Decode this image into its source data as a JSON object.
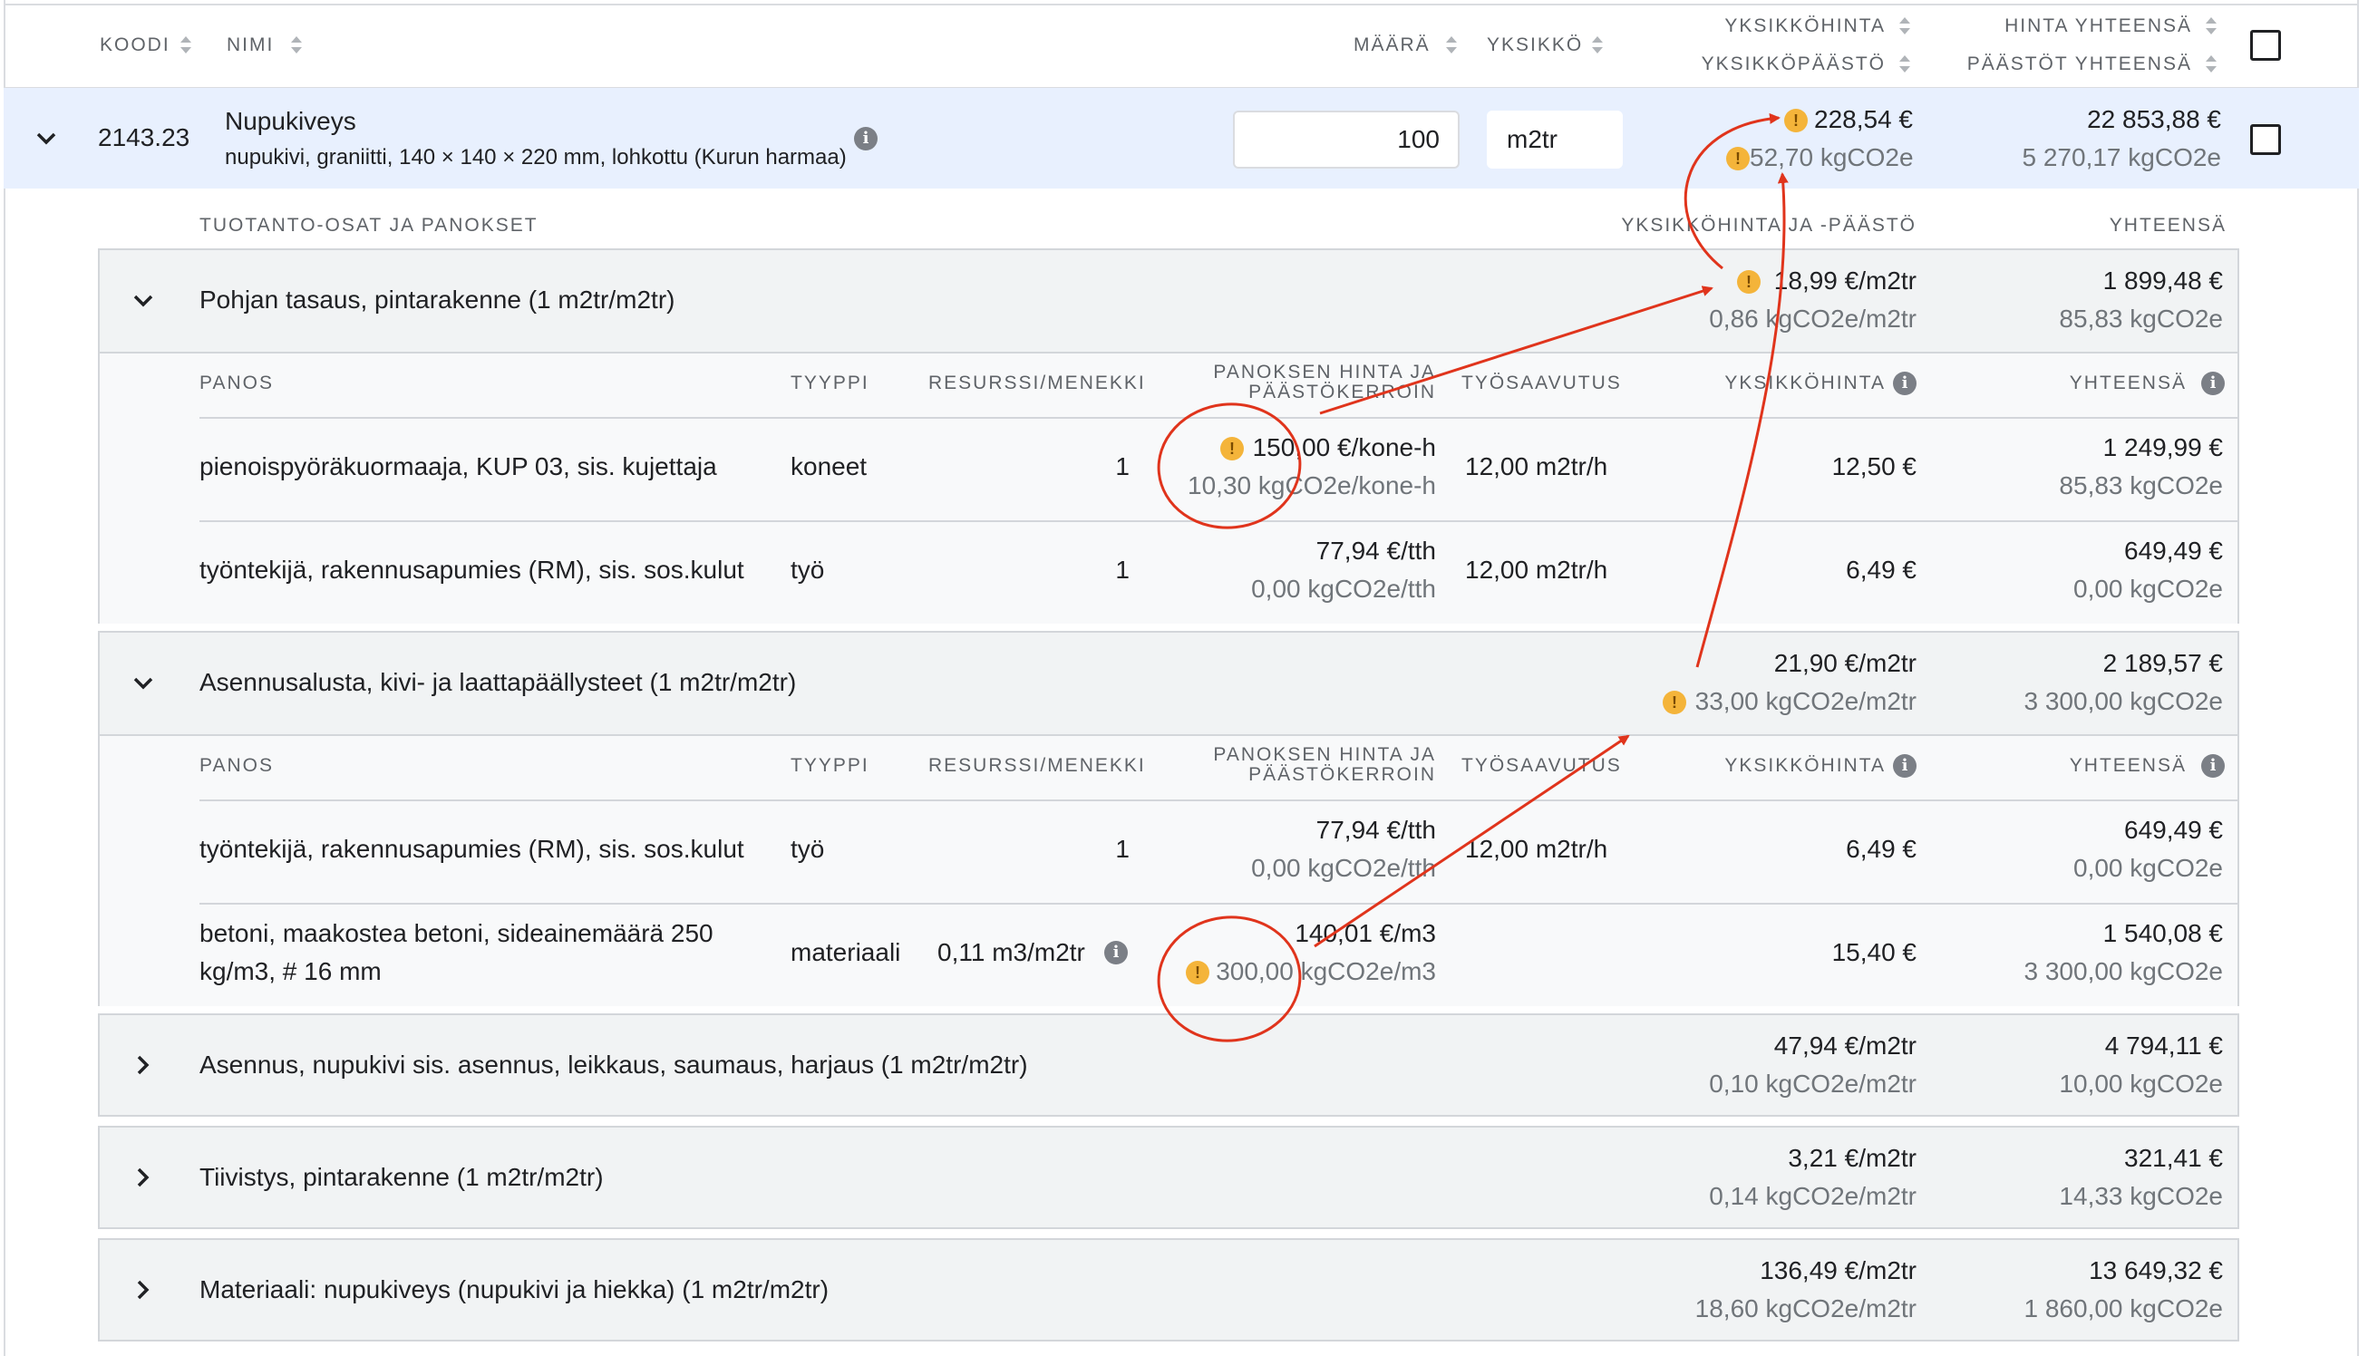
{
  "header": {
    "koodi": "KOODI",
    "nimi": "NIMI",
    "maara": "MÄÄRÄ",
    "yksikko": "YKSIKKÖ",
    "yksikkohinta": "YKSIKKÖHINTA",
    "yksikkopaasto": "YKSIKKÖPÄÄSTÖ",
    "hinta_yhteensa": "HINTA YHTEENSÄ",
    "paastot_yhteensa": "PÄÄSTÖT YHTEENSÄ"
  },
  "main_row": {
    "code": "2143.23",
    "name": "Nupukiveys",
    "description": "nupukivi, graniitti, 140 × 140 × 220 mm, lohkottu (Kurun harmaa)",
    "quantity": "100",
    "unit": "m2tr",
    "unit_price": "228,54 €",
    "unit_emission": "52,70 kgCO2e",
    "total_price": "22 853,88 €",
    "total_emission": "5 270,17 kgCO2e"
  },
  "section_headers": {
    "parts": "TUOTANTO-OSAT JA PANOKSET",
    "unit_price_emission": "YKSIKKÖHINTA JA -PÄÄSTÖ",
    "total": "YHTEENSÄ"
  },
  "sub_headers": {
    "panos": "PANOS",
    "tyyppi": "TYYPPI",
    "resurssi": "RESURSSI/MENEKKI",
    "panoksen_line1": "PANOKSEN HINTA JA",
    "panoksen_line2": "PÄÄSTÖKERROIN",
    "tyosaavutus": "TYÖSAAVUTUS",
    "yksikkohinta": "YKSIKKÖHINTA",
    "yhteensa": "YHTEENSÄ"
  },
  "parts": [
    {
      "title": "Pohjan tasaus, pintarakenne (1 m2tr/m2tr)",
      "unit_price": "18,99 €/m2tr",
      "unit_emission": "0,86 kgCO2e/m2tr",
      "total_price": "1 899,48 €",
      "total_emission": "85,83 kgCO2e",
      "inputs": [
        {
          "name": "pienoispyöräkuormaaja, KUP 03, sis. kujettaja",
          "type": "koneet",
          "resource": "1",
          "price": "150,00 €/kone-h",
          "factor": "10,30 kgCO2e/kone-h",
          "productivity": "12,00 m2tr/h",
          "unit_price": "12,50 €",
          "total_price": "1 249,99 €",
          "total_emission": "85,83 kgCO2e"
        },
        {
          "name": "työntekijä, rakennusapumies (RM), sis. sos.kulut",
          "type": "työ",
          "resource": "1",
          "price": "77,94 €/tth",
          "factor": "0,00 kgCO2e/tth",
          "productivity": "12,00 m2tr/h",
          "unit_price": "6,49 €",
          "total_price": "649,49 €",
          "total_emission": "0,00 kgCO2e"
        }
      ]
    },
    {
      "title": "Asennusalusta, kivi- ja laattapäällysteet (1 m2tr/m2tr)",
      "unit_price": "21,90 €/m2tr",
      "unit_emission": "33,00 kgCO2e/m2tr",
      "total_price": "2 189,57 €",
      "total_emission": "3 300,00 kgCO2e",
      "inputs": [
        {
          "name": "työntekijä, rakennusapumies (RM), sis. sos.kulut",
          "type": "työ",
          "resource": "1",
          "price": "77,94 €/tth",
          "factor": "0,00 kgCO2e/tth",
          "productivity": "12,00 m2tr/h",
          "unit_price": "6,49 €",
          "total_price": "649,49 €",
          "total_emission": "0,00 kgCO2e"
        },
        {
          "name_line1": "betoni, maakostea betoni, sideainemäärä 250",
          "name_line2": "kg/m3, # 16 mm",
          "type": "materiaali",
          "resource": "0,11 m3/m2tr",
          "price": "140,01 €/m3",
          "factor": "300,00 kgCO2e/m3",
          "unit_price": "15,40 €",
          "total_price": "1 540,08 €",
          "total_emission": "3 300,00 kgCO2e"
        }
      ]
    },
    {
      "title": "Asennus, nupukivi sis. asennus, leikkaus, saumaus, harjaus (1 m2tr/m2tr)",
      "unit_price": "47,94 €/m2tr",
      "unit_emission": "0,10 kgCO2e/m2tr",
      "total_price": "4 794,11 €",
      "total_emission": "10,00 kgCO2e"
    },
    {
      "title": "Tiivistys, pintarakenne (1 m2tr/m2tr)",
      "unit_price": "3,21 €/m2tr",
      "unit_emission": "0,14 kgCO2e/m2tr",
      "total_price": "321,41 €",
      "total_emission": "14,33 kgCO2e"
    },
    {
      "title": "Materiaali: nupukiveys (nupukivi ja hiekka) (1 m2tr/m2tr)",
      "unit_price": "136,49 €/m2tr",
      "unit_emission": "18,60 kgCO2e/m2tr",
      "total_price": "13 649,32 €",
      "total_emission": "1 860,00 kgCO2e"
    }
  ],
  "icons": {
    "info": "info-icon",
    "warning": "warning-icon",
    "chevron_down": "chevron-down-icon",
    "chevron_right": "chevron-right-icon",
    "sort": "sort-icon"
  },
  "colors": {
    "row_highlight": "#e8f0fe",
    "warning": "#f4b43a",
    "annotation": "#e0341c"
  }
}
